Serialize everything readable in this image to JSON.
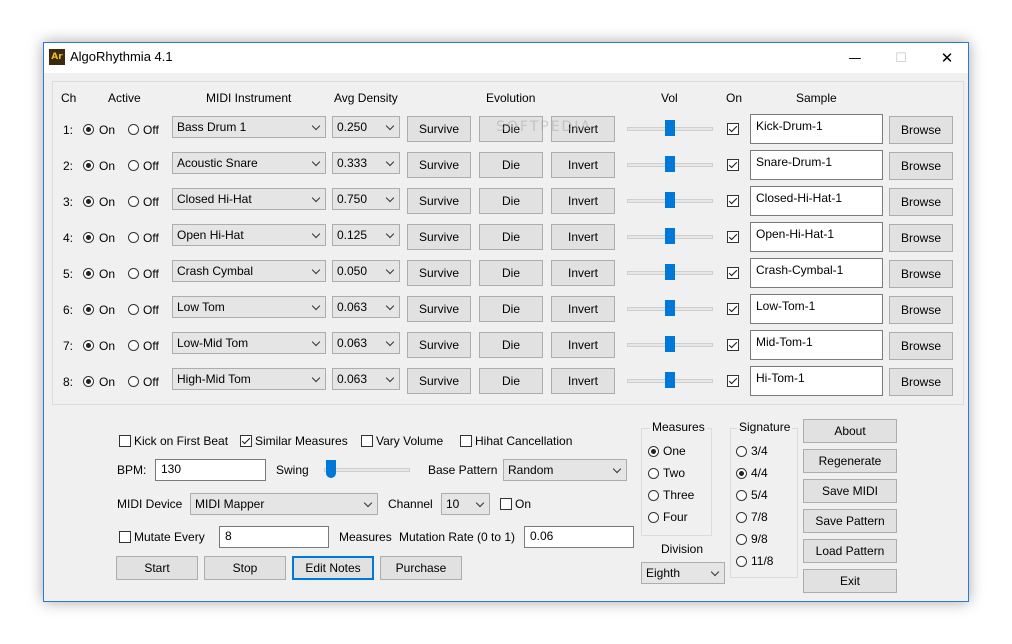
{
  "window": {
    "title": "AlgoRhythmia 4.1",
    "icon_text": "Ar",
    "minimize": "—",
    "maximize": "☐",
    "close": "✕"
  },
  "headers": {
    "ch": "Ch",
    "active": "Active",
    "midi_instrument": "MIDI Instrument",
    "avg_density": "Avg Density",
    "evolution": "Evolution",
    "vol": "Vol",
    "on": "On",
    "sample": "Sample"
  },
  "labels": {
    "on": "On",
    "off": "Off",
    "survive": "Survive",
    "die": "Die",
    "invert": "Invert",
    "browse": "Browse"
  },
  "watermark": "SOFTPEDIA",
  "channels": [
    {
      "ch": "1:",
      "active": "on",
      "instrument": "Bass Drum 1",
      "density": "0.250",
      "enabled": true,
      "sample": "Kick-Drum-1"
    },
    {
      "ch": "2:",
      "active": "on",
      "instrument": "Acoustic Snare",
      "density": "0.333",
      "enabled": true,
      "sample": "Snare-Drum-1"
    },
    {
      "ch": "3:",
      "active": "on",
      "instrument": "Closed Hi-Hat",
      "density": "0.750",
      "enabled": true,
      "sample": "Closed-Hi-Hat-1"
    },
    {
      "ch": "4:",
      "active": "on",
      "instrument": "Open Hi-Hat",
      "density": "0.125",
      "enabled": true,
      "sample": "Open-Hi-Hat-1"
    },
    {
      "ch": "5:",
      "active": "on",
      "instrument": "Crash Cymbal",
      "density": "0.050",
      "enabled": true,
      "sample": "Crash-Cymbal-1"
    },
    {
      "ch": "6:",
      "active": "on",
      "instrument": "Low Tom",
      "density": "0.063",
      "enabled": true,
      "sample": "Low-Tom-1"
    },
    {
      "ch": "7:",
      "active": "on",
      "instrument": "Low-Mid Tom",
      "density": "0.063",
      "enabled": true,
      "sample": "Mid-Tom-1"
    },
    {
      "ch": "8:",
      "active": "on",
      "instrument": "High-Mid Tom",
      "density": "0.063",
      "enabled": true,
      "sample": "Hi-Tom-1"
    }
  ],
  "options": {
    "kick_on_first_beat": {
      "label": "Kick on First Beat",
      "checked": false
    },
    "similar_measures": {
      "label": "Similar Measures",
      "checked": true
    },
    "vary_volume": {
      "label": "Vary Volume",
      "checked": false
    },
    "hihat_cancellation": {
      "label": "Hihat Cancellation",
      "checked": false
    }
  },
  "bpm": {
    "label": "BPM:",
    "value": "130"
  },
  "swing": {
    "label": "Swing"
  },
  "base_pattern": {
    "label": "Base Pattern",
    "value": "Random"
  },
  "midi_device": {
    "label": "MIDI Device",
    "value": "MIDI Mapper"
  },
  "channel": {
    "label": "Channel",
    "value": "10",
    "on_label": "On",
    "on_checked": false
  },
  "mutate": {
    "label": "Mutate Every",
    "checked": false,
    "value": "8",
    "unit": "Measures",
    "rate_label": "Mutation Rate (0 to 1)",
    "rate_value": "0.06"
  },
  "transport": {
    "start": "Start",
    "stop": "Stop",
    "edit_notes": "Edit Notes",
    "purchase": "Purchase"
  },
  "measures": {
    "title": "Measures",
    "options": [
      "One",
      "Two",
      "Three",
      "Four"
    ],
    "selected": 0
  },
  "division": {
    "label": "Division",
    "value": "Eighth"
  },
  "signature": {
    "title": "Signature",
    "options": [
      "3/4",
      "4/4",
      "5/4",
      "7/8",
      "9/8",
      "11/8"
    ],
    "selected": 1
  },
  "actions": {
    "about": "About",
    "regenerate": "Regenerate",
    "save_midi": "Save MIDI",
    "save_pattern": "Save Pattern",
    "load_pattern": "Load Pattern",
    "exit": "Exit"
  },
  "colors": {
    "accent": "#0078d7",
    "window_border": "#2b79d4",
    "face": "#f0f0f0"
  }
}
